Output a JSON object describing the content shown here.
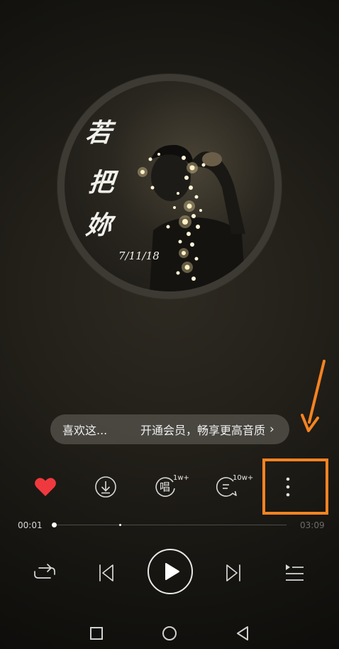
{
  "album": {
    "title_chars": [
      "若",
      "把",
      "妳"
    ],
    "date": "7/11/18"
  },
  "banner": {
    "song_text": "喜欢这...",
    "promo_text": "开通会员，畅享更高音质",
    "chevron": "›"
  },
  "actions": {
    "like_icon": "heart-icon",
    "download_icon": "download-icon",
    "sing_icon": "sing-icon",
    "sing_glyph": "唱",
    "sing_count": "1w+",
    "comment_icon": "comment-icon",
    "comment_count": "10w+",
    "more_icon": "more-vertical-icon"
  },
  "progress": {
    "current": "00:01",
    "total": "03:09",
    "played_fraction": 0.0,
    "buffered_fraction": 0.28
  },
  "controls": {
    "repeat_icon": "repeat-icon",
    "prev_icon": "previous-icon",
    "play_icon": "play-icon",
    "next_icon": "next-icon",
    "playlist_icon": "playlist-icon"
  },
  "navbar": {
    "recent_icon": "square-icon",
    "home_icon": "circle-icon",
    "back_icon": "triangle-back-icon"
  },
  "colors": {
    "heart": "#f0393f",
    "highlight": "#f58321",
    "arrow": "#f58321"
  }
}
